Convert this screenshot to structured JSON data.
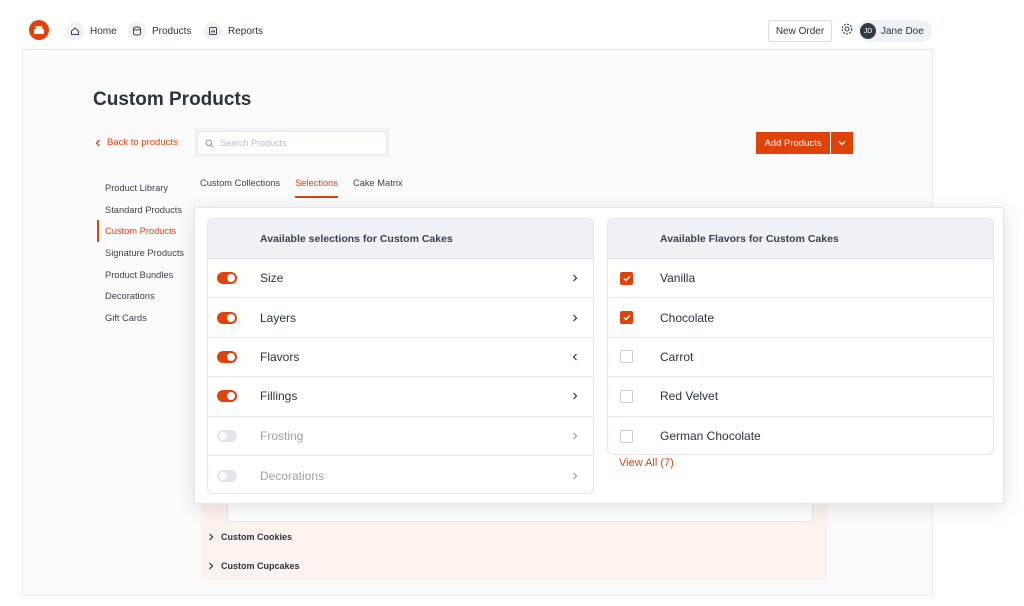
{
  "topbar": {
    "nav": [
      {
        "label": "Home",
        "icon": "home-icon"
      },
      {
        "label": "Products",
        "icon": "database-icon"
      },
      {
        "label": "Reports",
        "icon": "report-icon"
      }
    ],
    "new_order_label": "New Order",
    "user": {
      "initials": "JD",
      "name": "Jane Doe"
    }
  },
  "page": {
    "title": "Custom Products",
    "back_label": "Back to products",
    "search_placeholder": "Search Products",
    "add_button_label": "Add Products"
  },
  "sidebar": {
    "items": [
      {
        "label": "Product Library",
        "active": false
      },
      {
        "label": "Standard Products",
        "active": false
      },
      {
        "label": "Custom Products",
        "active": true
      },
      {
        "label": "Signature Products",
        "active": false
      },
      {
        "label": "Product Bundles",
        "active": false
      },
      {
        "label": "Decorations",
        "active": false
      },
      {
        "label": "Gift Cards",
        "active": false
      }
    ]
  },
  "tabs": [
    {
      "label": "Custom Collections",
      "active": false
    },
    {
      "label": "Selections",
      "active": true
    },
    {
      "label": "Cake Matrix",
      "active": false
    }
  ],
  "selections_card": {
    "title": "Available selections for Custom Cakes",
    "rows": [
      {
        "label": "Size",
        "enabled": true,
        "chevron": "right"
      },
      {
        "label": "Layers",
        "enabled": true,
        "chevron": "right"
      },
      {
        "label": "Flavors",
        "enabled": true,
        "chevron": "left"
      },
      {
        "label": "Fillings",
        "enabled": true,
        "chevron": "right"
      },
      {
        "label": "Frosting",
        "enabled": false,
        "chevron": "right"
      },
      {
        "label": "Decorations",
        "enabled": false,
        "chevron": "right"
      }
    ]
  },
  "flavors_card": {
    "title": "Available Flavors for Custom Cakes",
    "rows": [
      {
        "label": "Vanilla",
        "checked": true
      },
      {
        "label": "Chocolate",
        "checked": true
      },
      {
        "label": "Carrot",
        "checked": false
      },
      {
        "label": "Red Velvet",
        "checked": false
      },
      {
        "label": "German Chocolate",
        "checked": false
      }
    ],
    "view_all_label": "View All (7)"
  },
  "background_rows": [
    {
      "label": "Custom Cookies"
    },
    {
      "label": "Custom Cupcakes"
    }
  ],
  "colors": {
    "accent": "#e0420c",
    "text": "#2b3240",
    "header_bg": "#eef1f5"
  }
}
